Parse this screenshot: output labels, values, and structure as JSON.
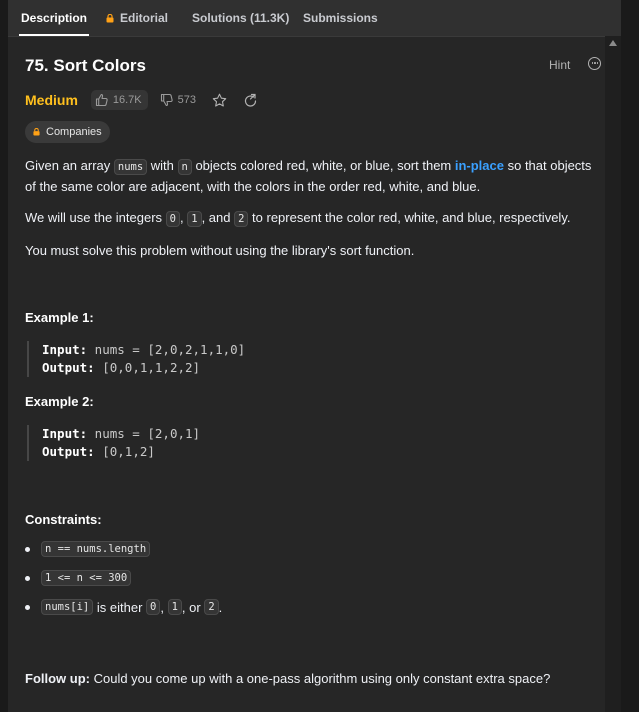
{
  "tabs": [
    {
      "label": "Description",
      "active": true,
      "locked": false
    },
    {
      "label": "Editorial",
      "active": false,
      "locked": true
    },
    {
      "label": "Solutions (11.3K)",
      "active": false,
      "locked": false
    },
    {
      "label": "Submissions",
      "active": false,
      "locked": false
    }
  ],
  "problem": {
    "title": "75. Sort Colors",
    "hint_label": "Hint",
    "difficulty": "Medium",
    "likes": "16.7K",
    "dislikes": "573",
    "companies_label": "Companies"
  },
  "description": {
    "p1_a": "Given an array ",
    "p1_code1": "nums",
    "p1_b": " with ",
    "p1_code2": "n",
    "p1_c": " objects colored red, white, or blue, sort them ",
    "p1_link": "in-place",
    "p1_d": " so that objects of the same color are adjacent, with the colors in the order red, white, and blue.",
    "p2_a": "We will use the integers ",
    "p2_code1": "0",
    "p2_b": ", ",
    "p2_code2": "1",
    "p2_c": ", and ",
    "p2_code3": "2",
    "p2_d": " to represent the color red, white, and blue, respectively.",
    "p3": "You must solve this problem without using the library's sort function."
  },
  "examples": [
    {
      "title": "Example 1:",
      "input_label": "Input:",
      "input": " nums = [2,0,2,1,1,0]",
      "output_label": "Output:",
      "output": " [0,0,1,1,2,2]"
    },
    {
      "title": "Example 2:",
      "input_label": "Input:",
      "input": " nums = [2,0,1]",
      "output_label": "Output:",
      "output": " [0,1,2]"
    }
  ],
  "constraints": {
    "title": "Constraints:",
    "c1_code": "n == nums.length",
    "c2_code": "1 <= n <= 300",
    "c3_code1": "nums[i]",
    "c3_a": " is either ",
    "c3_code2": "0",
    "c3_b": ", ",
    "c3_code3": "1",
    "c3_c": ", or ",
    "c3_code4": "2",
    "c3_d": "."
  },
  "follow_up": {
    "label": "Follow up:",
    "text": " Could you come up with a one-pass algorithm using only constant extra space?"
  },
  "colors": {
    "medium": "#ffc01e",
    "link": "#3aa0ff",
    "background": "#262626"
  }
}
